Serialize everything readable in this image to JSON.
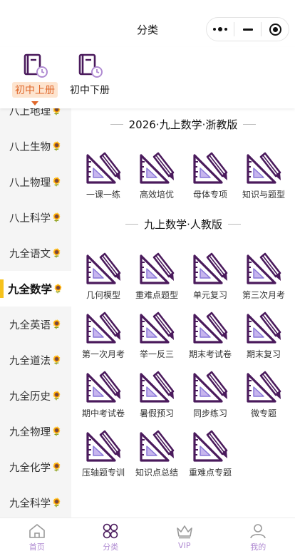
{
  "header": {
    "title": "分类"
  },
  "categories": [
    {
      "label": "初中上册",
      "icon": "book-clock-icon",
      "active": true
    },
    {
      "label": "初中下册",
      "icon": "book-clock-icon",
      "active": false
    }
  ],
  "sidebar": {
    "items": [
      {
        "label": "八上地理",
        "badge": "🌻"
      },
      {
        "label": "八上生物",
        "badge": "🌻"
      },
      {
        "label": "八上物理",
        "badge": "🌻"
      },
      {
        "label": "八上科学",
        "badge": "🌻"
      },
      {
        "label": "九全语文",
        "badge": "🌻"
      },
      {
        "label": "九全数学",
        "badge": "🌻",
        "active": true
      },
      {
        "label": "九全英语",
        "badge": "🌻"
      },
      {
        "label": "九全道法",
        "badge": "🌻"
      },
      {
        "label": "九全历史",
        "badge": "🌻"
      },
      {
        "label": "九全物理",
        "badge": "🌻"
      },
      {
        "label": "九全化学",
        "badge": "🌻"
      },
      {
        "label": "九全科学",
        "badge": "🌻"
      }
    ]
  },
  "sections": [
    {
      "title": "2026·九上数学·浙教版",
      "items": [
        "一课一练",
        "高效培优",
        "母体专项",
        "知识与题型"
      ]
    },
    {
      "title": "九上数学·人教版",
      "items": [
        "几何模型",
        "重难点题型",
        "单元复习",
        "第三次月考",
        "第一次月考",
        "举一反三",
        "期末考试卷",
        "期末复习",
        "期中考试卷",
        "暑假预习",
        "同步练习",
        "微专题",
        "压轴题专训",
        "知识点总结",
        "重难点专题"
      ]
    }
  ],
  "nav": [
    {
      "label": "首页",
      "icon": "home-icon"
    },
    {
      "label": "分类",
      "icon": "category-icon",
      "active": true
    },
    {
      "label": "VIP",
      "icon": "crown-icon"
    },
    {
      "label": "我的",
      "icon": "user-icon"
    }
  ],
  "colors": {
    "accent": "#e0672a",
    "purple": "#4a1a5c",
    "lavender": "#b08bd2",
    "highlight": "#f6c21c"
  }
}
